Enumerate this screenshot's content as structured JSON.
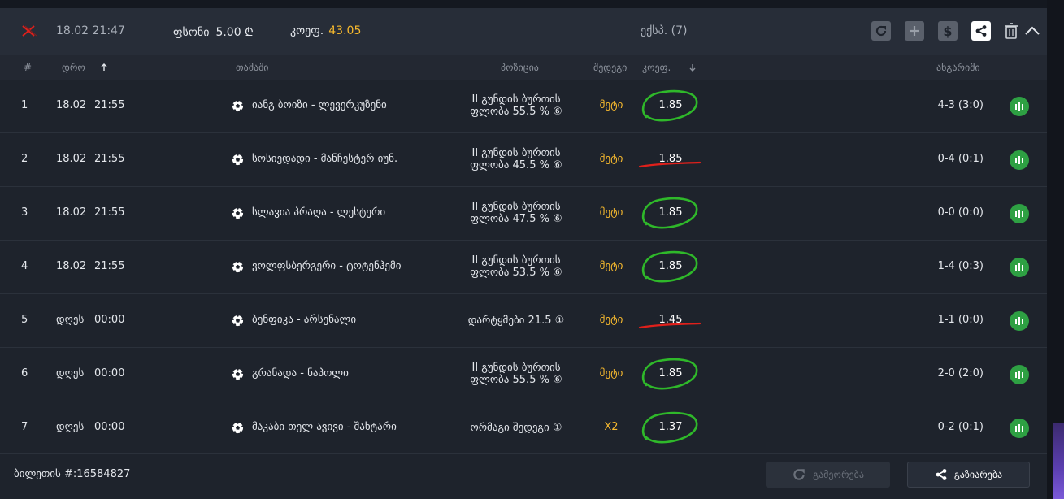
{
  "header": {
    "datetime": "18.02  21:47",
    "stake_label": "ფსონი",
    "stake_value": "5.00 ₾",
    "coef_label": "კოეფ.",
    "coef_value": "43.05",
    "express": "ექსპ. (7)"
  },
  "columns": {
    "num": "#",
    "date": "დრო",
    "game": "თამაში",
    "position": "პოზიცია",
    "outcome": "შედეგი",
    "odd": "კოეფ.",
    "score": "ანგარიში"
  },
  "rows": [
    {
      "num": "1",
      "date": "18.02",
      "time": "21:55",
      "game": "იანგ ბოიზი - ლევერკუზენი",
      "position_l1": "II გუნდის ბურთის",
      "position_l2": "ფლობა 55.5 % ⑥",
      "outcome": "მეტი",
      "odd": "1.85",
      "score": "4-3 (3:0)",
      "mark": "won"
    },
    {
      "num": "2",
      "date": "18.02",
      "time": "21:55",
      "game": "სოსიედადი - მანჩესტერ იუნ.",
      "position_l1": "II გუნდის ბურთის",
      "position_l2": "ფლობა 45.5 % ⑥",
      "outcome": "მეტი",
      "odd": "1.85",
      "score": "0-4 (0:1)",
      "mark": "lost"
    },
    {
      "num": "3",
      "date": "18.02",
      "time": "21:55",
      "game": "სლავია პრაღა - ლესტერი",
      "position_l1": "II გუნდის ბურთის",
      "position_l2": "ფლობა 47.5 % ⑥",
      "outcome": "მეტი",
      "odd": "1.85",
      "score": "0-0 (0:0)",
      "mark": "won"
    },
    {
      "num": "4",
      "date": "18.02",
      "time": "21:55",
      "game": "ვოლფსბერგერი - ტოტენჰემი",
      "position_l1": "II გუნდის ბურთის",
      "position_l2": "ფლობა 53.5 % ⑥",
      "outcome": "მეტი",
      "odd": "1.85",
      "score": "1-4 (0:3)",
      "mark": "won"
    },
    {
      "num": "5",
      "date": "დღეს",
      "time": "00:00",
      "game": "ბენფიკა - არსენალი",
      "position_l1": "დარტყმები 21.5 ①",
      "position_l2": "",
      "outcome": "მეტი",
      "odd": "1.45",
      "score": "1-1 (0:0)",
      "mark": "lost"
    },
    {
      "num": "6",
      "date": "დღეს",
      "time": "00:00",
      "game": "გრანადა - ნაპოლი",
      "position_l1": "II გუნდის ბურთის",
      "position_l2": "ფლობა 55.5 % ⑥",
      "outcome": "მეტი",
      "odd": "1.85",
      "score": "2-0 (2:0)",
      "mark": "won"
    },
    {
      "num": "7",
      "date": "დღეს",
      "time": "00:00",
      "game": "მაკაბი თელ ავივი - შახტარი",
      "position_l1": "ორმაგი შედეგი ①",
      "position_l2": "",
      "outcome": "X2",
      "odd": "1.37",
      "score": "0-2 (0:1)",
      "mark": "won"
    }
  ],
  "footer": {
    "ticket": "ბილეთის #:16584827",
    "repeat_label": "გამეორება",
    "share_label": "გაზიარება"
  },
  "colors": {
    "accent": "#f5b82e",
    "win_mark": "#2fb82a",
    "lose_mark": "#e0201b",
    "stat_green": "#2ea043"
  }
}
